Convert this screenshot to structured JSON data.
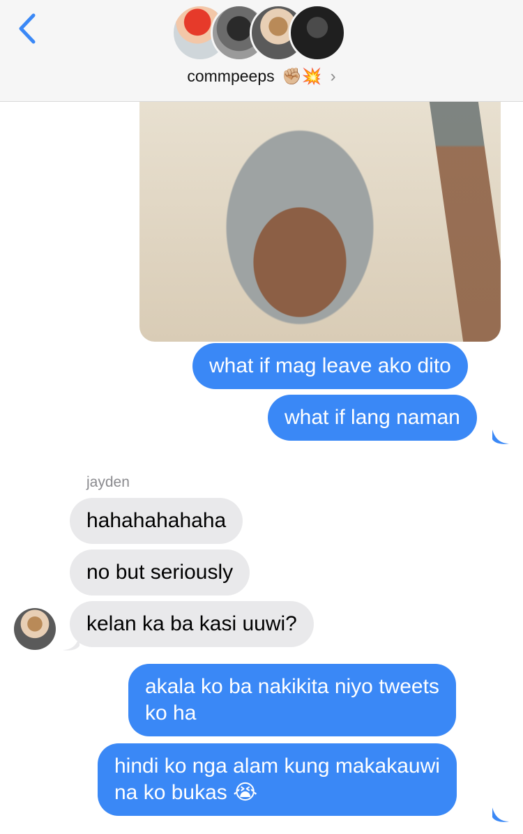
{
  "header": {
    "back_icon": "chevron-left-icon",
    "group_name": "commpeeps",
    "group_emoji": "✊🏼💥",
    "chevron": "›",
    "member_avatars": [
      "avatar-red-hair",
      "avatar-sunglasses-phone",
      "avatar-brown-hair",
      "avatar-peace-sign"
    ]
  },
  "messages": [
    {
      "type": "image",
      "direction": "outgoing"
    },
    {
      "direction": "outgoing",
      "text": "what if mag leave ako dito"
    },
    {
      "direction": "outgoing",
      "text": "what if lang naman"
    },
    {
      "direction": "incoming",
      "sender": "jayden",
      "text": "hahahahahaha"
    },
    {
      "direction": "incoming",
      "text": "no but seriously"
    },
    {
      "direction": "incoming",
      "text": "kelan ka ba kasi uuwi?"
    },
    {
      "direction": "outgoing",
      "line1": "akala ko ba nakikita niyo tweets",
      "line2": "ko ha"
    },
    {
      "direction": "outgoing",
      "line1": "hindi ko nga alam kung makakauwi",
      "line2": "na ko bukas 😭"
    }
  ],
  "colors": {
    "outgoing_bubble": "#3a88f6",
    "incoming_bubble": "#e9e9eb",
    "accent": "#3a88f6",
    "header_bg": "#f6f6f6"
  }
}
